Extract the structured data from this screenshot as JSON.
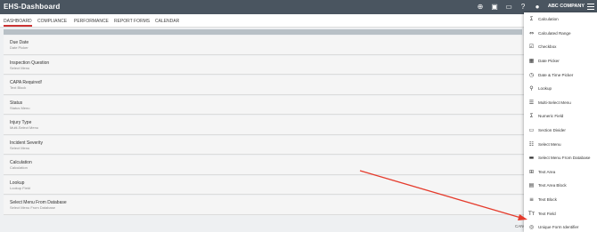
{
  "app": {
    "logo": "EHS-Dashboard",
    "company": "ABC COMPANY"
  },
  "nav": {
    "tabs": [
      "DASHBOARD",
      "COMPLIANCE",
      "PERFORMANCE",
      "REPORT FORMS",
      "CALENDAR"
    ]
  },
  "fields": [
    {
      "label": "Due Date",
      "type": "Date Picker"
    },
    {
      "label": "Inspection Question",
      "type": "Select Menu"
    },
    {
      "label": "CAPA Required!",
      "type": "Text Block"
    },
    {
      "label": "Status",
      "type": "Status Menu"
    },
    {
      "label": "Injury Type",
      "type": "Multi-Select Menu"
    },
    {
      "label": "Incident Severity",
      "type": "Select Menu"
    },
    {
      "label": "Calculation",
      "type": "Calculation"
    },
    {
      "label": "Lookup",
      "type": "Lookup Field"
    },
    {
      "label": "Select Menu From Database",
      "type": "Select Menu From Database"
    }
  ],
  "footer": {
    "cancel": "CANC"
  },
  "panel": {
    "items": [
      {
        "label": "Calculation",
        "icon": "sigma-icon"
      },
      {
        "label": "Calculated Range",
        "icon": "range-icon"
      },
      {
        "label": "Checkbox",
        "icon": "checkbox-icon"
      },
      {
        "label": "Date Picker",
        "icon": "calendar-icon"
      },
      {
        "label": "Date & Time Picker",
        "icon": "clock-icon"
      },
      {
        "label": "Lookup",
        "icon": "search-icon"
      },
      {
        "label": "Multi-Select Menu",
        "icon": "list-icon"
      },
      {
        "label": "Numeric Field",
        "icon": "sigma-icon"
      },
      {
        "label": "Section Divider",
        "icon": "divider-icon"
      },
      {
        "label": "Select Menu",
        "icon": "list-icon"
      },
      {
        "label": "Select Menu From Database",
        "icon": "database-icon"
      },
      {
        "label": "Text Area",
        "icon": "textarea-icon"
      },
      {
        "label": "Text Area Block",
        "icon": "textarea-block-icon"
      },
      {
        "label": "Text Block",
        "icon": "lines-icon"
      },
      {
        "label": "Text Field",
        "icon": "text-icon"
      },
      {
        "label": "Unique Form Identifier",
        "icon": "fingerprint-icon"
      }
    ]
  },
  "colors": {
    "topbar": "#4a5560",
    "accent": "#c33",
    "arrow": "#e53b2c"
  }
}
